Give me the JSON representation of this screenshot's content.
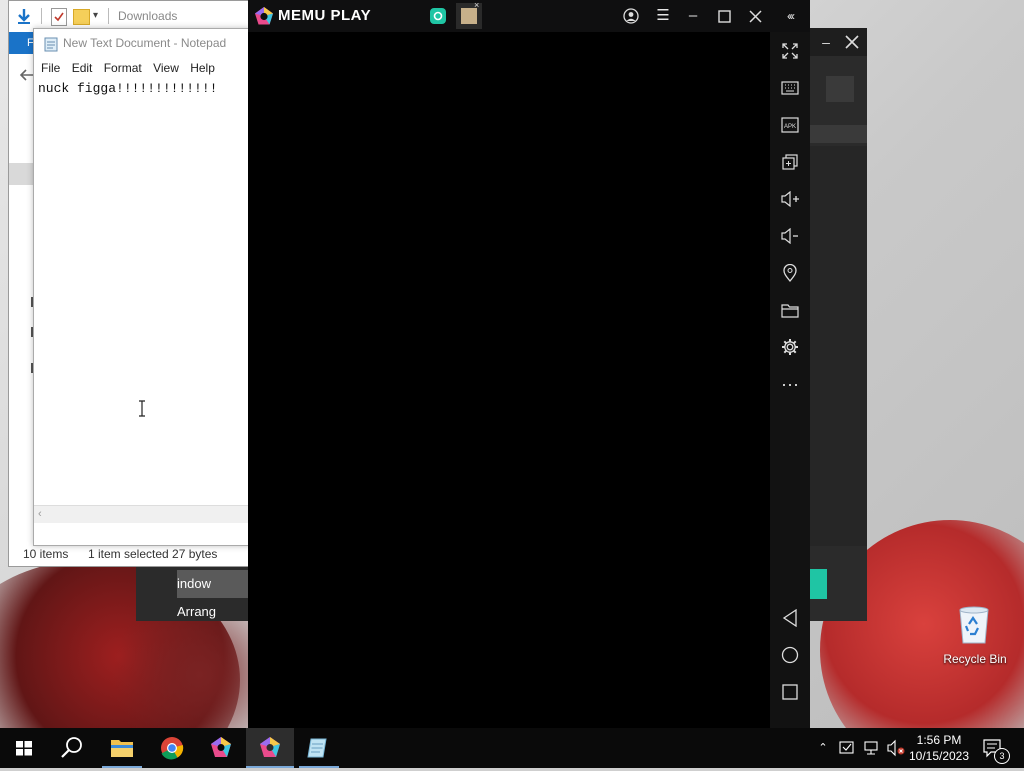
{
  "explorer": {
    "title": "Downloads",
    "ribbon_tab": "F",
    "status": {
      "items": "10 items",
      "selected": "1 item selected  27 bytes"
    }
  },
  "darkwin": {
    "partial_label": "indow Arrang"
  },
  "notepad": {
    "title": "New Text Document - Notepad",
    "menu": [
      "File",
      "Edit",
      "Format",
      "View",
      "Help"
    ],
    "content": "nuck figga!!!!!!!!!!!!!"
  },
  "memu": {
    "brand": "MEMU PLAY",
    "sidebar": [
      "fullscreen-icon",
      "keyboard-icon",
      "apk-icon",
      "multi-instance-icon",
      "volume-up-icon",
      "volume-down-icon",
      "location-icon",
      "folder-icon",
      "settings-icon",
      "more-icon"
    ],
    "nav": [
      "back-icon",
      "home-icon",
      "recents-icon"
    ]
  },
  "desktop": {
    "recycle_bin": "Recycle Bin"
  },
  "taskbar": {
    "time": "1:56 PM",
    "date": "10/15/2023",
    "notifications": "3"
  },
  "colors": {
    "accent": "#1a73c8",
    "memu_teal": "#1fc5a4",
    "taskbar": "#0a0a0a"
  }
}
